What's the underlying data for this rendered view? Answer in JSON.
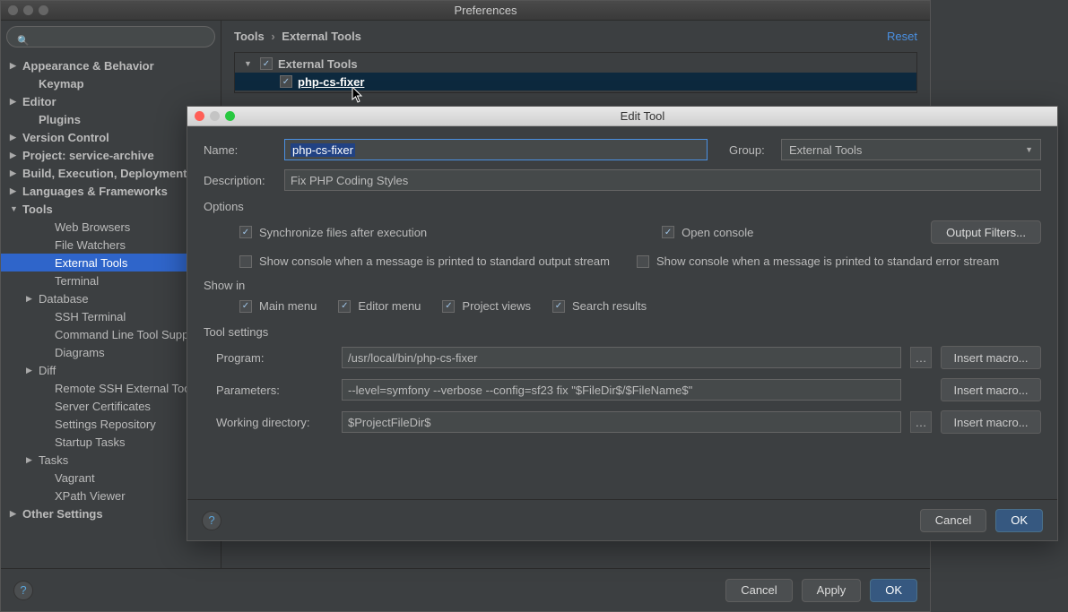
{
  "prefs": {
    "title": "Preferences",
    "search_placeholder": "",
    "sidebar": [
      {
        "label": "Appearance & Behavior",
        "arrow": "▶",
        "bold": true,
        "indent": 0
      },
      {
        "label": "Keymap",
        "arrow": "",
        "bold": true,
        "indent": 1
      },
      {
        "label": "Editor",
        "arrow": "▶",
        "bold": true,
        "indent": 0
      },
      {
        "label": "Plugins",
        "arrow": "",
        "bold": true,
        "indent": 1
      },
      {
        "label": "Version Control",
        "arrow": "▶",
        "bold": true,
        "indent": 0
      },
      {
        "label": "Project: service-archive",
        "arrow": "▶",
        "bold": true,
        "indent": 0
      },
      {
        "label": "Build, Execution, Deployment",
        "arrow": "▶",
        "bold": true,
        "indent": 0
      },
      {
        "label": "Languages & Frameworks",
        "arrow": "▶",
        "bold": true,
        "indent": 0
      },
      {
        "label": "Tools",
        "arrow": "▼",
        "bold": true,
        "indent": 0
      },
      {
        "label": "Web Browsers",
        "arrow": "",
        "bold": false,
        "indent": 2
      },
      {
        "label": "File Watchers",
        "arrow": "",
        "bold": false,
        "indent": 2
      },
      {
        "label": "External Tools",
        "arrow": "",
        "bold": false,
        "indent": 2,
        "selected": true
      },
      {
        "label": "Terminal",
        "arrow": "",
        "bold": false,
        "indent": 2
      },
      {
        "label": "Database",
        "arrow": "▶",
        "bold": false,
        "indent": 1
      },
      {
        "label": "SSH Terminal",
        "arrow": "",
        "bold": false,
        "indent": 2
      },
      {
        "label": "Command Line Tool Support",
        "arrow": "",
        "bold": false,
        "indent": 2
      },
      {
        "label": "Diagrams",
        "arrow": "",
        "bold": false,
        "indent": 2
      },
      {
        "label": "Diff",
        "arrow": "▶",
        "bold": false,
        "indent": 1
      },
      {
        "label": "Remote SSH External Tools",
        "arrow": "",
        "bold": false,
        "indent": 2
      },
      {
        "label": "Server Certificates",
        "arrow": "",
        "bold": false,
        "indent": 2
      },
      {
        "label": "Settings Repository",
        "arrow": "",
        "bold": false,
        "indent": 2
      },
      {
        "label": "Startup Tasks",
        "arrow": "",
        "bold": false,
        "indent": 2
      },
      {
        "label": "Tasks",
        "arrow": "▶",
        "bold": false,
        "indent": 1
      },
      {
        "label": "Vagrant",
        "arrow": "",
        "bold": false,
        "indent": 2
      },
      {
        "label": "XPath Viewer",
        "arrow": "",
        "bold": false,
        "indent": 2
      },
      {
        "label": "Other Settings",
        "arrow": "▶",
        "bold": true,
        "indent": 0
      }
    ],
    "breadcrumb": {
      "a": "Tools",
      "b": "External Tools"
    },
    "reset": "Reset",
    "ext_tree": {
      "group": "External Tools",
      "item": "php-cs-fixer"
    },
    "footer": {
      "cancel": "Cancel",
      "apply": "Apply",
      "ok": "OK"
    }
  },
  "dialog": {
    "title": "Edit Tool",
    "labels": {
      "name": "Name:",
      "group": "Group:",
      "description": "Description:",
      "options": "Options",
      "sync": "Synchronize files after execution",
      "open_console": "Open console",
      "output_filters": "Output Filters...",
      "stdout": "Show console when a message is printed to standard output stream",
      "stderr": "Show console when a message is printed to standard error stream",
      "show_in": "Show in",
      "main_menu": "Main menu",
      "editor_menu": "Editor menu",
      "project_views": "Project views",
      "search_results": "Search results",
      "tool_settings": "Tool settings",
      "program": "Program:",
      "parameters": "Parameters:",
      "working_dir": "Working directory:",
      "insert_macro": "Insert macro...",
      "cancel": "Cancel",
      "ok": "OK"
    },
    "values": {
      "name": "php-cs-fixer",
      "group": "External Tools",
      "description": "Fix PHP Coding Styles",
      "program": "/usr/local/bin/php-cs-fixer",
      "parameters": "--level=symfony --verbose --config=sf23 fix \"$FileDir$/$FileName$\"",
      "working_dir": "$ProjectFileDir$"
    }
  }
}
